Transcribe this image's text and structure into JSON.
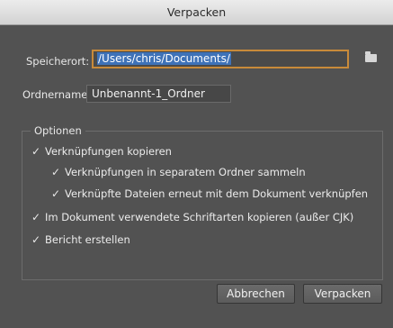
{
  "window": {
    "title": "Verpacken"
  },
  "location": {
    "label": "Speicherort:",
    "value": "/Users/chris/Documents/",
    "browse_icon": "folder-icon"
  },
  "folder_name": {
    "label": "Ordnername:",
    "value": "Unbenannt-1_Ordner"
  },
  "options": {
    "legend": "Optionen",
    "items": [
      {
        "label": "Verknüpfungen kopieren",
        "checked": true
      },
      {
        "label": "Verknüpfungen in separatem Ordner sammeln",
        "checked": true
      },
      {
        "label": "Verknüpfte Dateien erneut mit dem Dokument verknüpfen",
        "checked": true
      },
      {
        "label": "Im Dokument verwendete Schriftarten kopieren (außer CJK)",
        "checked": true
      },
      {
        "label": "Bericht erstellen",
        "checked": true
      }
    ]
  },
  "buttons": {
    "cancel": "Abbrechen",
    "ok": "Verpacken"
  },
  "colors": {
    "background": "#525252",
    "focus_ring": "#c88a3a",
    "selection": "#3e72b8"
  }
}
